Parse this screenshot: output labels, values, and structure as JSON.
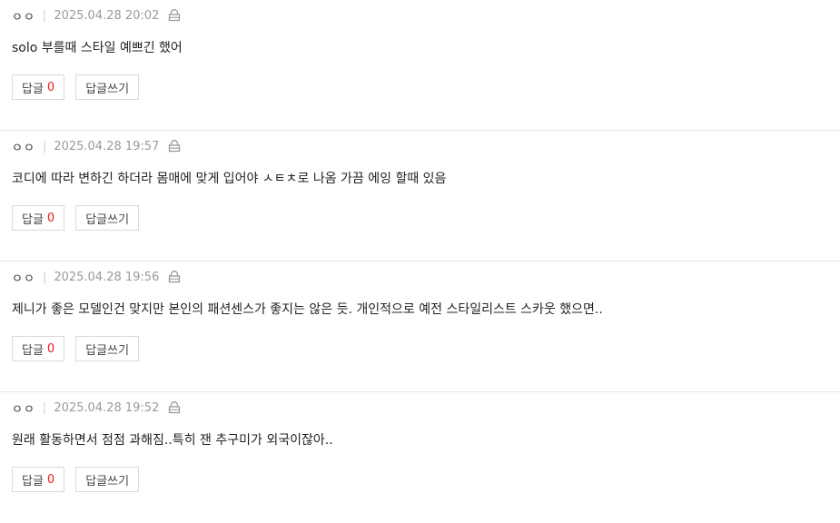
{
  "colors": {
    "count_red": "#e0232a",
    "date_gray": "#9a9a9a",
    "divider": "#e6e6e6"
  },
  "icons": {
    "lock": "lock-icon"
  },
  "comments": [
    {
      "author": "ㅇㅇ",
      "separator": "|",
      "date": "2025.04.28 20:02",
      "text": "solo 부를때 스타일 예쁘긴 했어",
      "reply_label": "답글",
      "reply_count": "0",
      "write_reply_label": "답글쓰기"
    },
    {
      "author": "ㅇㅇ",
      "separator": "|",
      "date": "2025.04.28 19:57",
      "text": "코디에 따라 변하긴 하더라 몸매에 맞게 입어야 ㅅㅌㅊ로 나옴 가끔 에잉 할때 있음",
      "reply_label": "답글",
      "reply_count": "0",
      "write_reply_label": "답글쓰기"
    },
    {
      "author": "ㅇㅇ",
      "separator": "|",
      "date": "2025.04.28 19:56",
      "text": "제니가 좋은 모델인건 맞지만 본인의 패션센스가 좋지는 않은 듯. 개인적으로 예전 스타일리스트 스카웃 했으면..",
      "reply_label": "답글",
      "reply_count": "0",
      "write_reply_label": "답글쓰기"
    },
    {
      "author": "ㅇㅇ",
      "separator": "|",
      "date": "2025.04.28 19:52",
      "text": "원래 활동하면서 점점 과해짐..특히 잰 추구미가 외국이잖아..",
      "reply_label": "답글",
      "reply_count": "0",
      "write_reply_label": "답글쓰기"
    }
  ]
}
